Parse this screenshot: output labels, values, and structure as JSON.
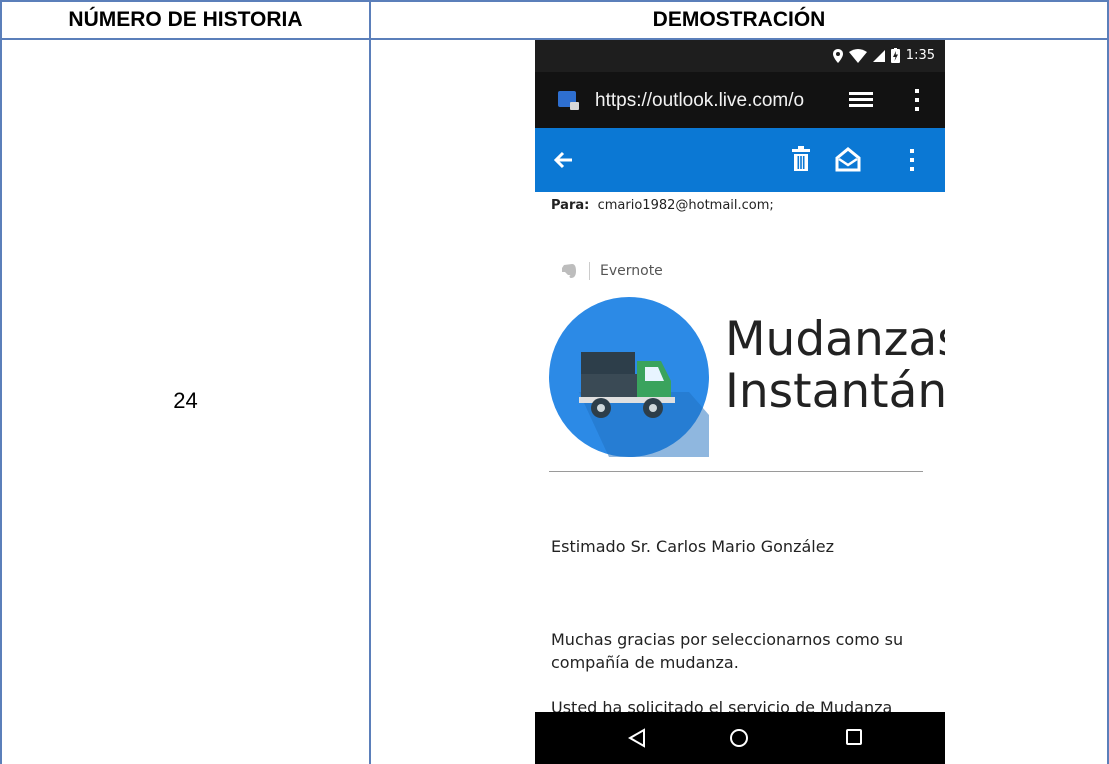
{
  "table": {
    "header_story_number": "NÚMERO DE HISTORIA",
    "header_demo": "DEMOSTRACIÓN",
    "story_number": "24"
  },
  "phone": {
    "status_bar": {
      "time": "1:35"
    },
    "browser": {
      "url": "https://outlook.live.com/o"
    },
    "email": {
      "to_label": "Para:",
      "to_value": "cmario1982@hotmail.com;",
      "sender_app": "Evernote",
      "brand_line1": "Mudanzas",
      "brand_line2": "Instantáne",
      "greeting": "Estimado Sr. Carlos Mario González",
      "body_paragraph": "Muchas gracias por seleccionarnos como su compañía de mudanza.",
      "body_partial": "Usted ha solicitado el servicio de Mudanza"
    },
    "colors": {
      "app_bar": "#0b78d4",
      "logo_circle": "#2c8ae6",
      "truck_cab": "#3aa35d"
    }
  }
}
